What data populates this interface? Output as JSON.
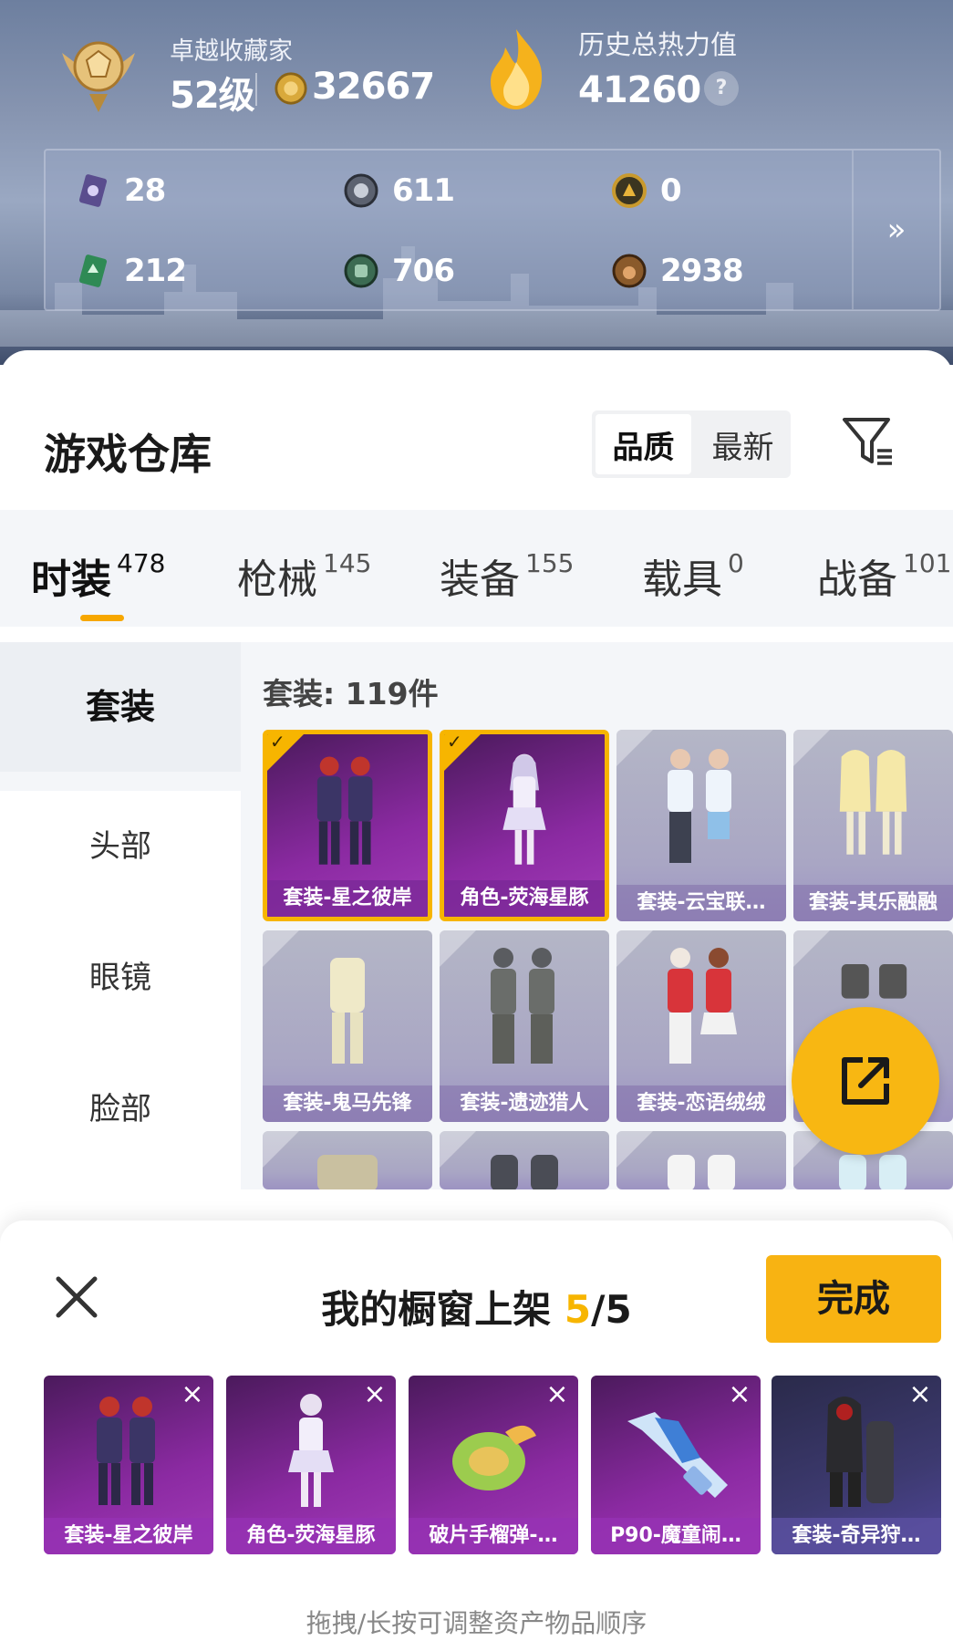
{
  "header": {
    "collector_title": "卓越收藏家",
    "level": "52级",
    "coins": "32667",
    "heat_title": "历史总热力值",
    "heat_value": "41260",
    "help": "?",
    "stats": [
      {
        "icon": "card-purple-icon",
        "value": "28"
      },
      {
        "icon": "silver-coin-icon",
        "value": "611"
      },
      {
        "icon": "gold-token-icon",
        "value": "0"
      },
      {
        "icon": "card-green-icon",
        "value": "212"
      },
      {
        "icon": "green-coin-icon",
        "value": "706"
      },
      {
        "icon": "bronze-coin-icon",
        "value": "2938"
      }
    ],
    "expand": "»"
  },
  "warehouse": {
    "title": "游戏仓库",
    "sort": {
      "quality": "品质",
      "newest": "最新",
      "active": "quality"
    },
    "tabs": [
      {
        "name": "时装",
        "count": "478",
        "active": true
      },
      {
        "name": "枪械",
        "count": "145"
      },
      {
        "name": "装备",
        "count": "155"
      },
      {
        "name": "载具",
        "count": "0"
      },
      {
        "name": "战备",
        "count": "101"
      }
    ],
    "side_nav": [
      "套装",
      "头部",
      "眼镜",
      "脸部"
    ],
    "set_count": "套装: 119件",
    "items": [
      {
        "label": "套装-星之彼岸",
        "selected": true,
        "style": "purple"
      },
      {
        "label": "角色-荧海星豚",
        "selected": true,
        "style": "purple"
      },
      {
        "label": "套装-云宝联…",
        "selected": false,
        "style": "gray"
      },
      {
        "label": "套装-其乐融融",
        "selected": false,
        "style": "gray"
      },
      {
        "label": "套装-鬼马先锋",
        "selected": false,
        "style": "gray"
      },
      {
        "label": "套装-遗迹猎人",
        "selected": false,
        "style": "gray"
      },
      {
        "label": "套装-恋语绒绒",
        "selected": false,
        "style": "gray"
      }
    ]
  },
  "sheet": {
    "title_prefix": "我的橱窗上架",
    "count_current": "5",
    "count_sep": "/",
    "count_total": "5",
    "done": "完成",
    "shelf": [
      {
        "label": "套装-星之彼岸"
      },
      {
        "label": "角色-荧海星豚"
      },
      {
        "label": "破片手榴弹-…"
      },
      {
        "label": "P90-魔童闹…"
      },
      {
        "label": "套装-奇异狩…"
      }
    ],
    "hint": "拖拽/长按可调整资产物品顺序"
  },
  "colors": {
    "accent": "#f7b500",
    "purple_tile": "#8b2aa2",
    "gray_tile": "#a9a6c4"
  }
}
